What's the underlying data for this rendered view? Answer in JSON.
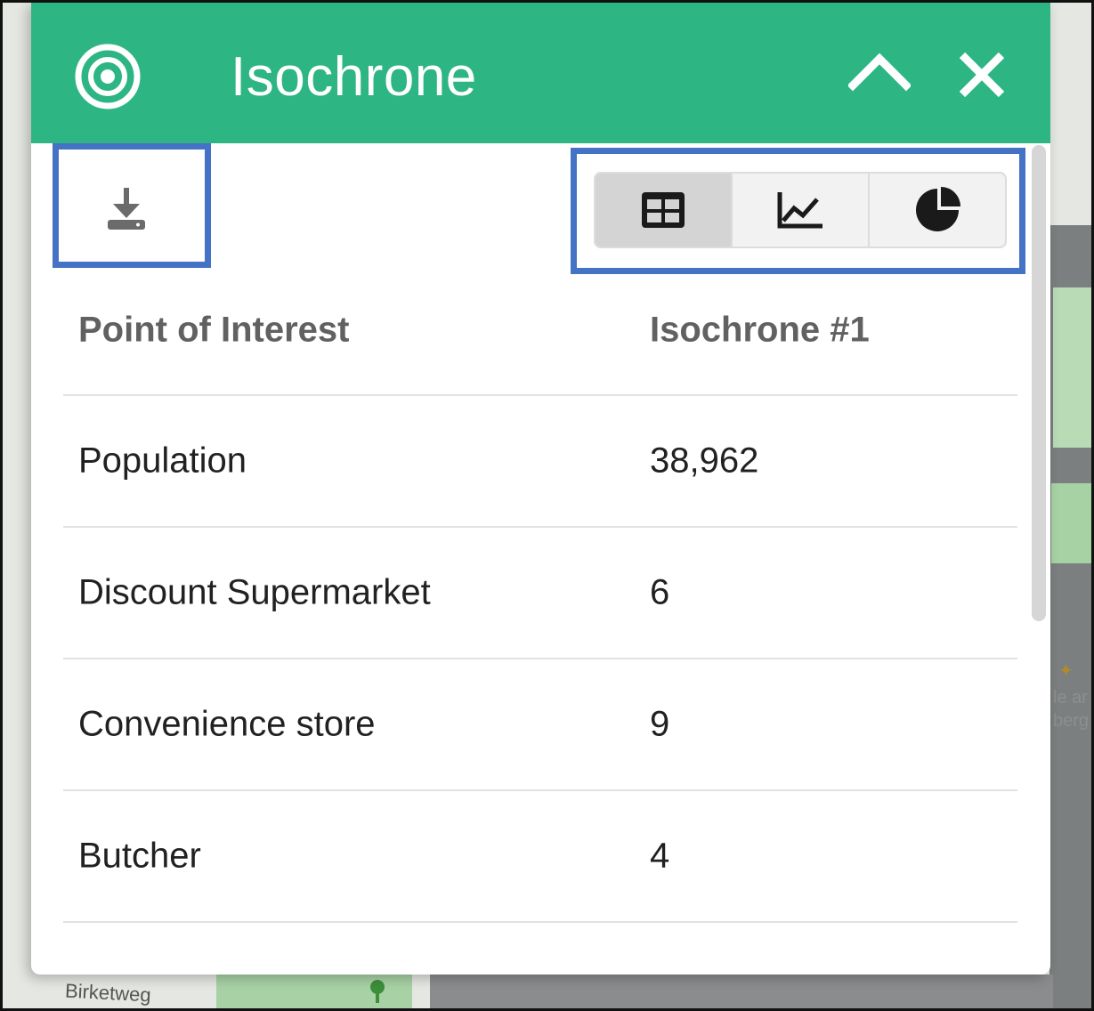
{
  "header": {
    "title": "Isochrone"
  },
  "toolbar": {
    "download_icon": "download-icon",
    "views": [
      {
        "icon": "table-icon",
        "active": true
      },
      {
        "icon": "line-chart-icon",
        "active": false
      },
      {
        "icon": "pie-chart-icon",
        "active": false
      }
    ]
  },
  "table": {
    "columns": [
      "Point of Interest",
      "Isochrone #1"
    ],
    "rows": [
      [
        "Population",
        "38,962"
      ],
      [
        "Discount Supermarket",
        "6"
      ],
      [
        "Convenience store",
        "9"
      ],
      [
        "Butcher",
        "4"
      ]
    ]
  },
  "map": {
    "street_label": "Birketweg",
    "edge_text": "le ar\nberg"
  },
  "colors": {
    "header": "#2db584",
    "highlight": "#4472c4",
    "active_view": "#d4d4d4"
  }
}
